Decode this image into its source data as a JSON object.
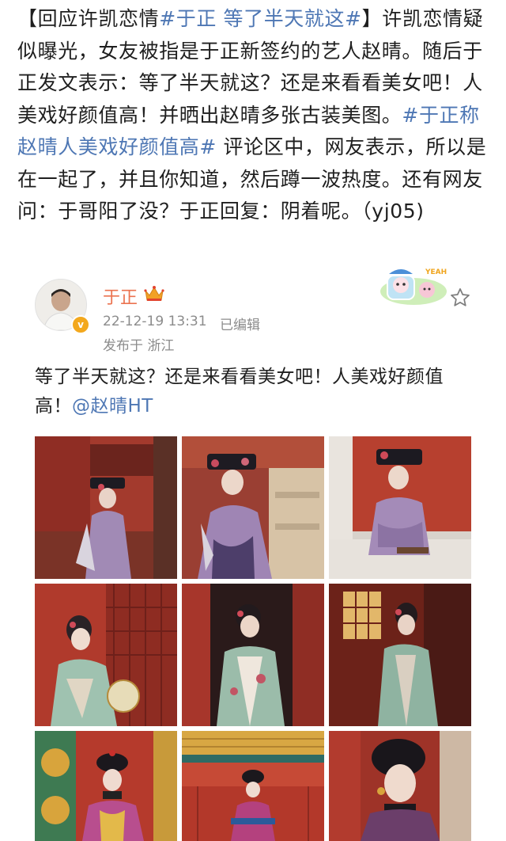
{
  "article": {
    "lead": "【回应许凯恋情",
    "hashtag1": "#于正 等了半天就这#",
    "body1": "】许凯恋情疑似曝光，女友被指是于正新签约的艺人赵晴。随后于正发文表示：等了半天就这？还是来看看美女吧！人美戏好颜值高！并晒出赵晴多张古装美图。",
    "hashtag2": "#于正称赵晴人美戏好颜值高#",
    "body2": " 评论区中，网友表示，所以是在一起了，并且你知道，然后蹲一波热度。还有网友问：于哥阳了没？于正回复：阴着呢。（yj05)"
  },
  "post": {
    "username": "于正",
    "verified_mark": "v",
    "time": "22-12-19 13:31",
    "edited": "已编辑",
    "location": "发布于 浙江",
    "sticker_text": "YEAH!",
    "text": "等了半天就这？还是来看看美女吧！人美戏好颜值高！",
    "mention": "@赵晴HT"
  },
  "icons": {
    "avatar": "avatar-image",
    "crown": "crown-icon",
    "star": "star-icon",
    "verified": "verified-badge"
  },
  "colors": {
    "hashtag": "#4e77b4",
    "username": "#eb7350",
    "meta": "#8c8c8c",
    "palace_red": "#a8312a"
  },
  "photos": [
    {
      "name": "photo-1"
    },
    {
      "name": "photo-2"
    },
    {
      "name": "photo-3"
    },
    {
      "name": "photo-4"
    },
    {
      "name": "photo-5"
    },
    {
      "name": "photo-6"
    },
    {
      "name": "photo-7"
    },
    {
      "name": "photo-8"
    },
    {
      "name": "photo-9"
    }
  ]
}
